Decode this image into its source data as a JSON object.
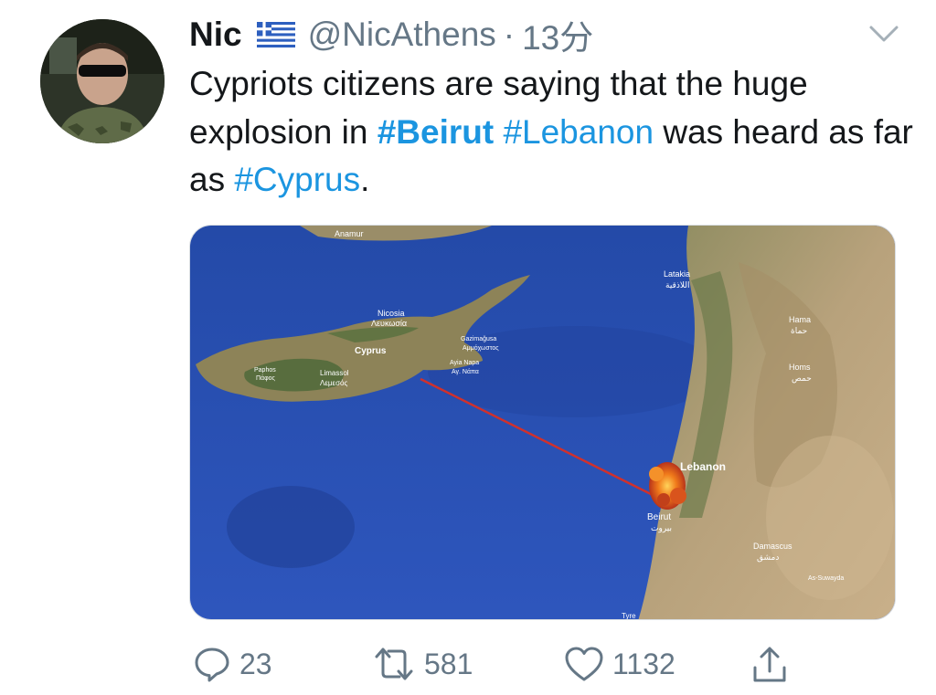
{
  "user": {
    "name": "Nic",
    "handle": "@NicAthens",
    "separator": "·",
    "time": "13分",
    "flag_icon": "greece-flag-icon",
    "avatar_icon": "profile-photo"
  },
  "tweet": {
    "t1": "Cypriots citizens are saying that the huge explosion in ",
    "h1": "#Beirut",
    "t2": " ",
    "h2": "#Lebanon",
    "t3": " was heard as far as ",
    "h3": "#Cyprus",
    "t4": "."
  },
  "map": {
    "labels": {
      "anamur": "Anamur",
      "latakia": "Latakia",
      "latakia_ar": "اللاذقية",
      "nicosia": "Nicosia",
      "nicosia_gr": "Λευκωσία",
      "cyprus": "Cyprus",
      "gazimagusa": "Gazimağusa",
      "ammochostos": "Αμμόχωστος",
      "ayia_napa": "Ayia Napa",
      "ay_napa": "Αγ. Νάπα",
      "paphos": "Paphos",
      "paphos_gr": "Πάφος",
      "limassol": "Limassol",
      "limassol_gr": "Λεμεσός",
      "hama": "Hama",
      "hama_ar": "حماة",
      "homs": "Homs",
      "homs_ar": "حمص",
      "lebanon": "Lebanon",
      "beirut": "Beirut",
      "beirut_ar": "بيروت",
      "damascus": "Damascus",
      "damascus_ar": "دمشق",
      "as_suwayda": "As-Suwayda",
      "tyre": "Tyre"
    },
    "colors": {
      "sea": "#2b52b8",
      "land": "#b4a07a",
      "route": "#d0312d",
      "fire": "#f07a1a"
    }
  },
  "actions": {
    "replies": "23",
    "retweets": "581",
    "likes": "1132",
    "reply_icon": "reply-icon",
    "retweet_icon": "retweet-icon",
    "like_icon": "heart-icon",
    "share_icon": "share-icon"
  }
}
